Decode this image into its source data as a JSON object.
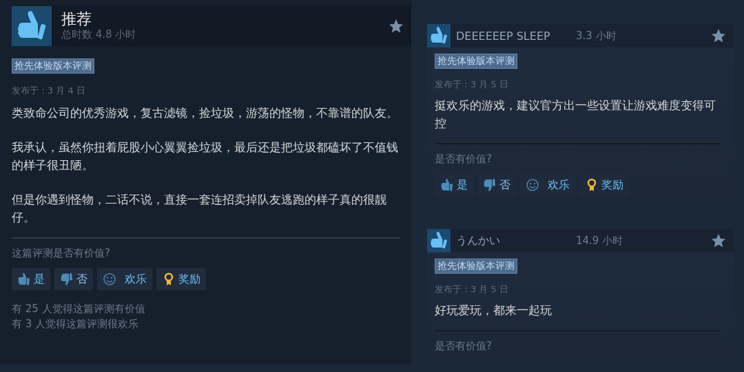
{
  "main_review": {
    "verdict": "推荐",
    "playtime": "总时数 4.8 小时",
    "tag": "抢先体验版本评测",
    "posted": "发布于：3 月 4 日",
    "paragraphs": [
      "类致命公司的优秀游戏，复古滤镜，捡垃圾，游荡的怪物，不靠谱的队友。",
      "我承认，虽然你扭着屁股小心翼翼捡垃圾，最后还是把垃圾都磕坏了不值钱的样子很丑陋。",
      "但是你遇到怪物，二话不说，直接一套连招卖掉队友逃跑的样子真的很靓仔。"
    ],
    "helpful_prompt": "这篇评测是否有价值?",
    "votes": [
      {
        "kind": "yes",
        "label": "是"
      },
      {
        "kind": "no",
        "label": "否"
      },
      {
        "kind": "funny",
        "label": "欢乐"
      },
      {
        "kind": "award",
        "label": "奖励"
      }
    ],
    "stats": [
      "有 25 人觉得这篇评测有价值",
      "有 3 人觉得这篇评测很欢乐"
    ]
  },
  "other_reviews": [
    {
      "author": "DEEEEEEP SLEEP",
      "hours": "3.3 小时",
      "tag": "抢先体验版本评测",
      "posted": "发布于：3 月 5 日",
      "text": "挺欢乐的游戏，建议官方出一些设置让游戏难度变得可控",
      "helpful_prompt": "是否有价值?",
      "votes": [
        {
          "kind": "yes",
          "label": "是"
        },
        {
          "kind": "no",
          "label": "否"
        },
        {
          "kind": "funny",
          "label": "欢乐"
        },
        {
          "kind": "award",
          "label": "奖励"
        }
      ]
    },
    {
      "author": "うんかい",
      "hours": "14.9 小时",
      "tag": "抢先体验版本评测",
      "posted": "发布于：3 月 5 日",
      "text": "好玩爱玩，都来一起玩",
      "helpful_prompt": "是否有价值?"
    }
  ]
}
